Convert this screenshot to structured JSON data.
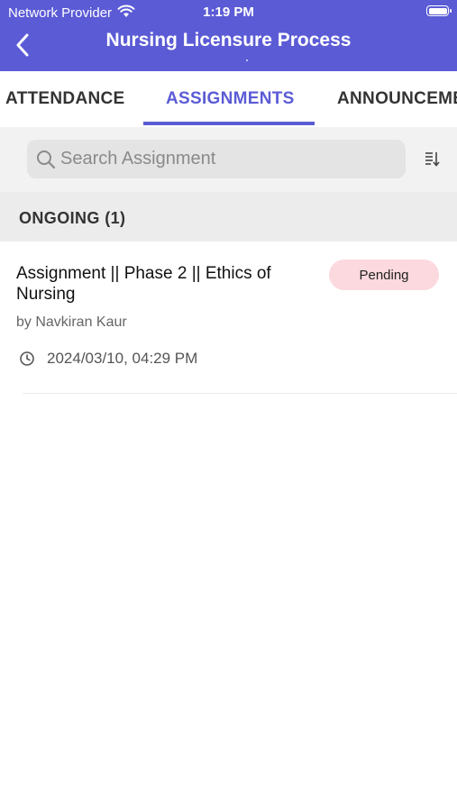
{
  "status_bar": {
    "carrier": "Network Provider",
    "time": "1:19 PM",
    "wifi_icon": "wifi-icon",
    "battery_icon": "battery-icon"
  },
  "header": {
    "title": "Nursing Licensure Process",
    "back_icon": "chevron-left-icon",
    "background_color": "#5b5bd6"
  },
  "tabs": [
    {
      "label": "ATTENDANCE",
      "active": false
    },
    {
      "label": "ASSIGNMENTS",
      "active": true
    },
    {
      "label": "ANNOUNCEMENTS",
      "active": false
    }
  ],
  "search": {
    "placeholder": "Search Assignment",
    "icon": "search-icon",
    "sort_icon": "sort-icon"
  },
  "section": {
    "label": "ONGOING (1)"
  },
  "assignments": [
    {
      "title": "Assignment || Phase 2 || Ethics of Nursing",
      "author": "by Navkiran Kaur",
      "date": "2024/03/10, 04:29 PM",
      "status": "Pending",
      "status_color": "#fbd9de"
    }
  ],
  "colors": {
    "accent": "#5b5bd6",
    "pending_badge": "#fbd9de"
  }
}
